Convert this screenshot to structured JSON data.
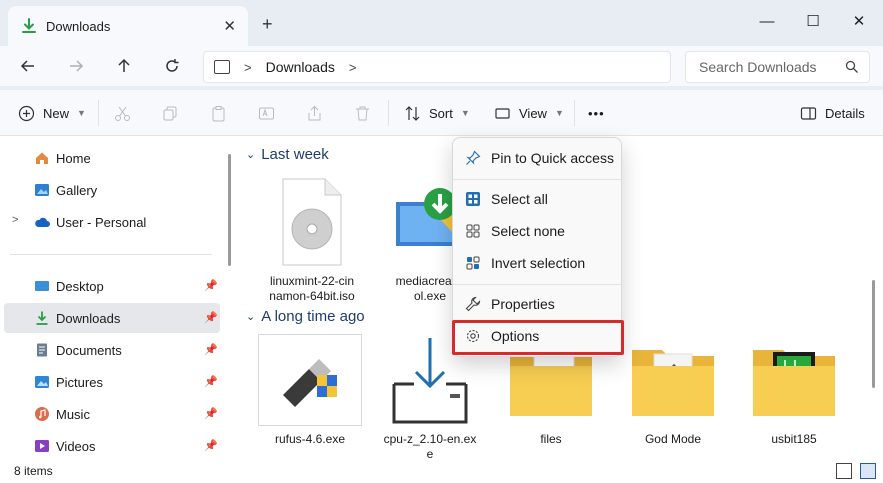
{
  "window": {
    "tab_title": "Downloads",
    "new_tab": "+",
    "minimize": "—",
    "maximize": "☐",
    "close": "✕",
    "tab_close": "✕"
  },
  "address": {
    "crumb": "Downloads",
    "search_placeholder": "Search Downloads"
  },
  "toolbar": {
    "new_label": "New",
    "sort_label": "Sort",
    "view_label": "View",
    "more_label": "•••",
    "details_label": "Details"
  },
  "sidebar": {
    "items": [
      {
        "label": "Home"
      },
      {
        "label": "Gallery"
      },
      {
        "label": "User - Personal"
      },
      {
        "label": "Desktop"
      },
      {
        "label": "Downloads"
      },
      {
        "label": "Documents"
      },
      {
        "label": "Pictures"
      },
      {
        "label": "Music"
      },
      {
        "label": "Videos"
      }
    ]
  },
  "groups": [
    {
      "label": "Last week"
    },
    {
      "label": "A long time ago"
    }
  ],
  "files": [
    {
      "name": "linuxmint-22-cinnamon-64bit.iso"
    },
    {
      "name": "mediacreationtool.exe"
    },
    {
      "name": "rufus-4.6.exe"
    },
    {
      "name": "cpu-z_2.10-en.exe"
    },
    {
      "name": "files"
    },
    {
      "name": "God Mode"
    },
    {
      "name": "usbit185"
    }
  ],
  "visible_names": {
    "mediacreationtool_line1": "mediacreatio",
    "mediacreationtool_line2": "ol.exe",
    "linuxmint_line1": "linuxmint-22-cin",
    "linuxmint_line2": "namon-64bit.iso",
    "cpuz_line1": "cpu-z_2.10-en.ex",
    "cpuz_line2": "e"
  },
  "context_menu": {
    "items": [
      {
        "label": "Pin to Quick access"
      },
      {
        "label": "Select all"
      },
      {
        "label": "Select none"
      },
      {
        "label": "Invert selection"
      },
      {
        "label": "Properties"
      },
      {
        "label": "Options"
      }
    ]
  },
  "status": {
    "item_count": "8 items"
  },
  "colors": {
    "accent": "#0f6cbd",
    "highlight_box": "#d52b2b",
    "folder": "#f4c444",
    "download_green": "#2a9d48"
  }
}
